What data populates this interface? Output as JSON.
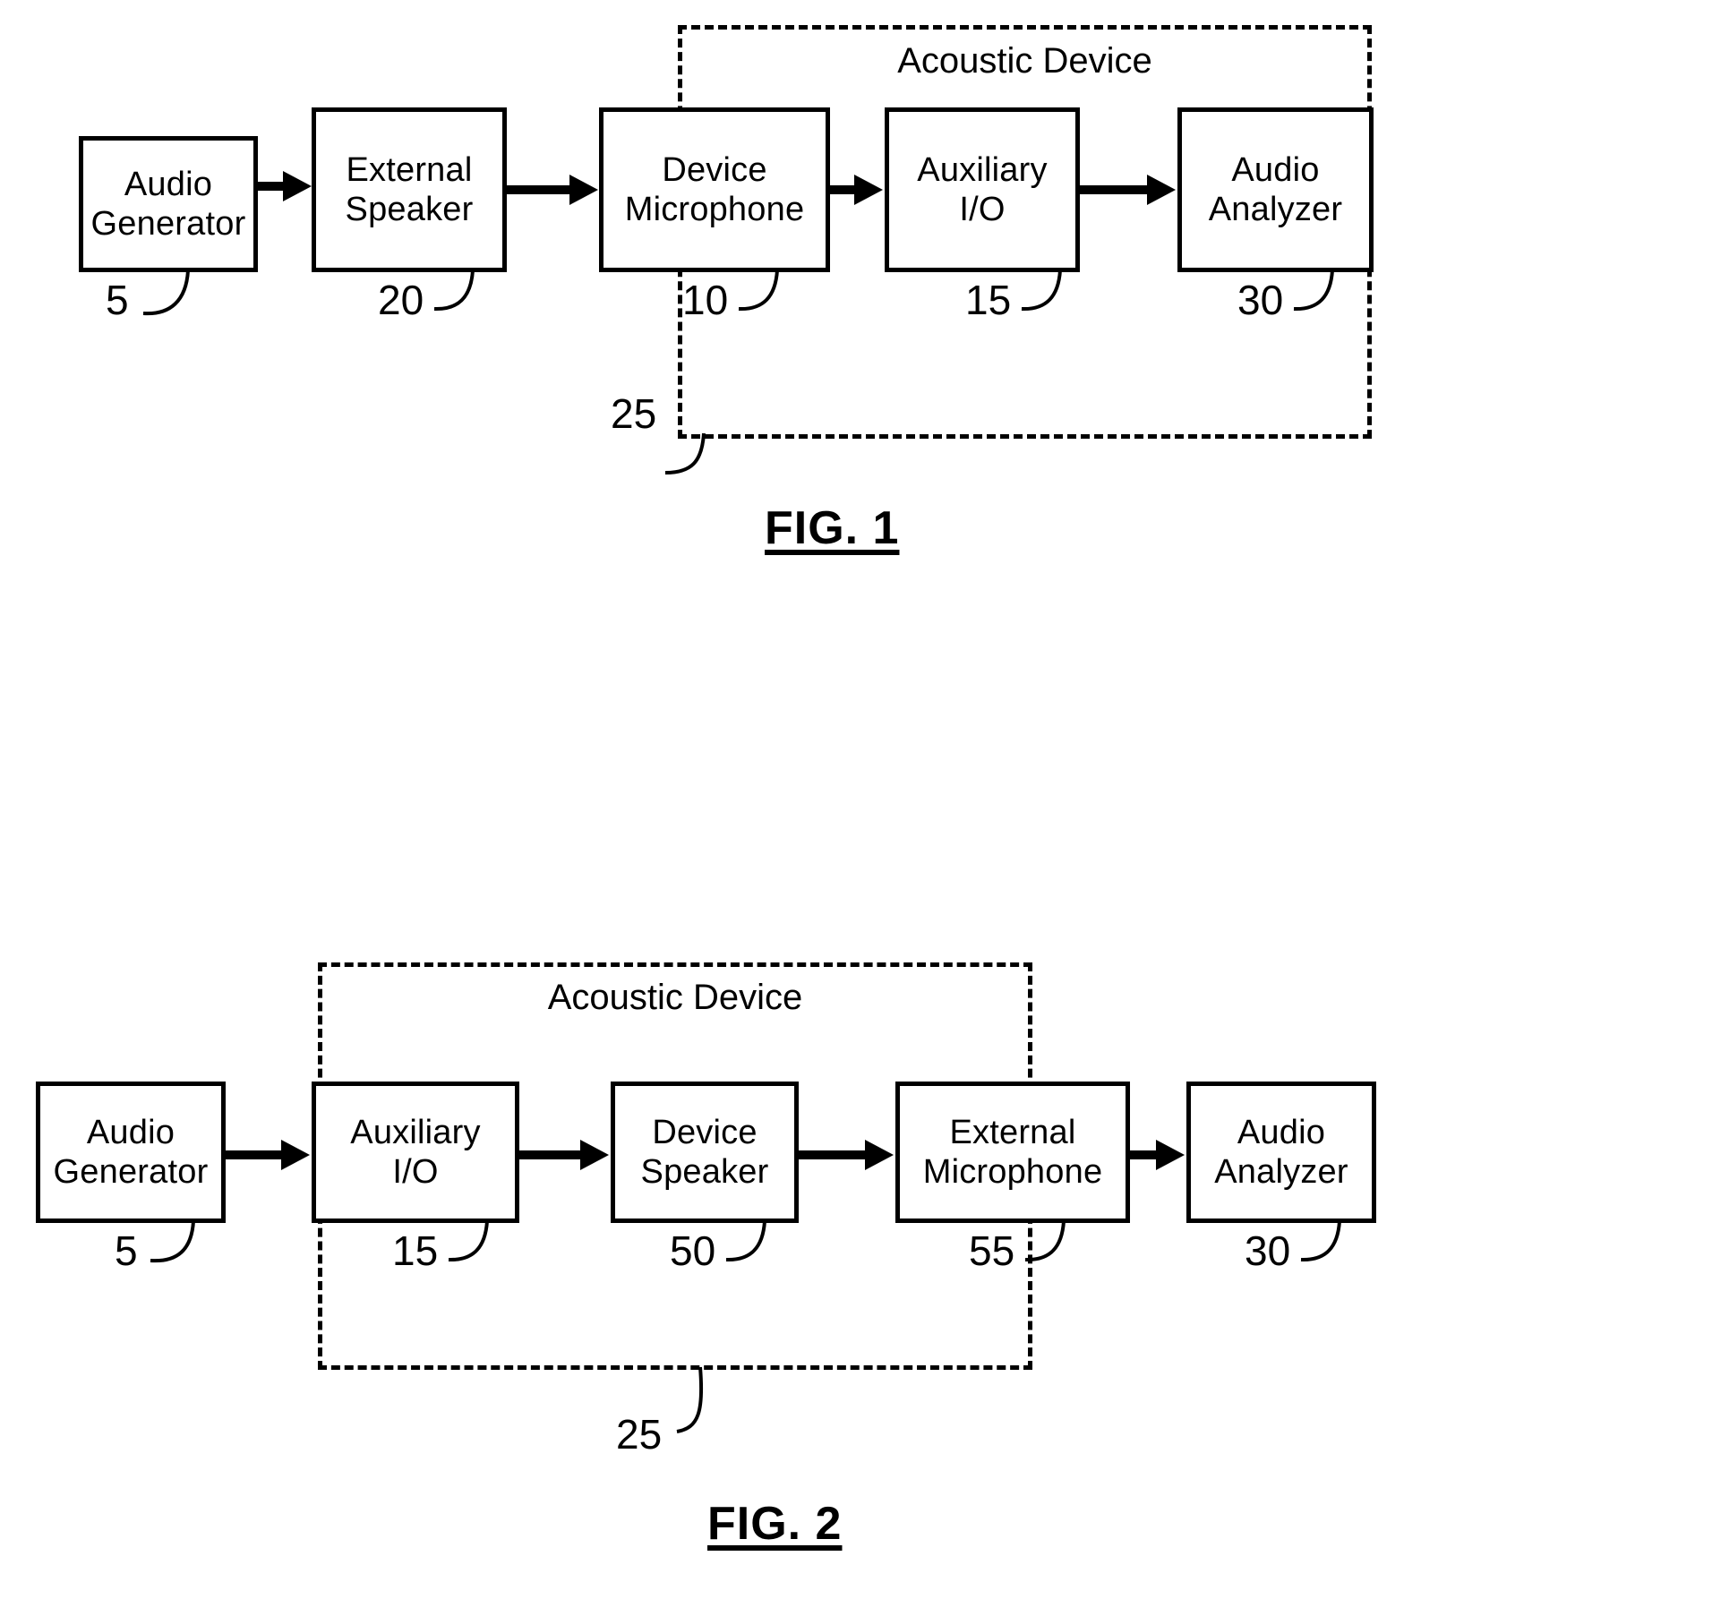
{
  "figures": [
    {
      "id": "fig-1",
      "caption": "FIG. 1",
      "enclosure": {
        "label": "Acoustic Device",
        "ref": "25"
      },
      "blocks": [
        {
          "label": "Audio\nGenerator",
          "ref": "5"
        },
        {
          "label": "External\nSpeaker",
          "ref": "20"
        },
        {
          "label": "Device\nMicrophone",
          "ref": "10"
        },
        {
          "label": "Auxiliary\nI/O",
          "ref": "15"
        },
        {
          "label": "Audio\nAnalyzer",
          "ref": "30"
        }
      ]
    },
    {
      "id": "fig-2",
      "caption": "FIG. 2",
      "enclosure": {
        "label": "Acoustic Device",
        "ref": "25"
      },
      "blocks": [
        {
          "label": "Audio\nGenerator",
          "ref": "5"
        },
        {
          "label": "Auxiliary\nI/O",
          "ref": "15"
        },
        {
          "label": "Device\nSpeaker",
          "ref": "50"
        },
        {
          "label": "External\nMicrophone",
          "ref": "55"
        },
        {
          "label": "Audio\nAnalyzer",
          "ref": "30"
        }
      ]
    }
  ],
  "colors": {
    "ink": "#000000",
    "paper": "#ffffff"
  }
}
